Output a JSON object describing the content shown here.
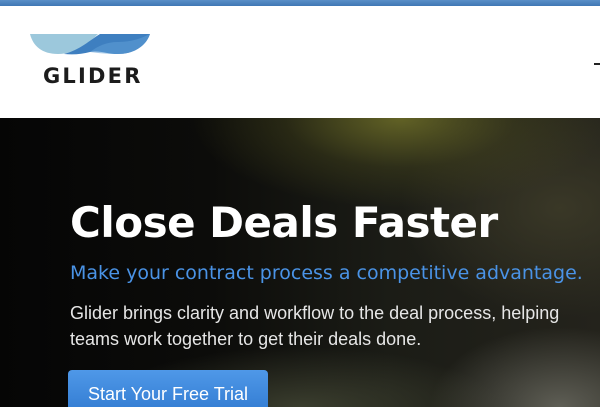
{
  "brand": {
    "name": "GLIDER",
    "logo_icon": "glider-wing-logo",
    "colors": {
      "accent": "#4a93e6",
      "logo_light": "#9cc8dc",
      "logo_dark": "#3e7fc0",
      "top_strip": "#4a85c2"
    }
  },
  "hero": {
    "title": "Close Deals Faster",
    "subtitle": "Make your contract process a competitive advantage.",
    "body": "Glider brings clarity and workflow to the deal process, helping teams work together to get their deals done.",
    "cta_label": "Start Your Free Trial"
  }
}
